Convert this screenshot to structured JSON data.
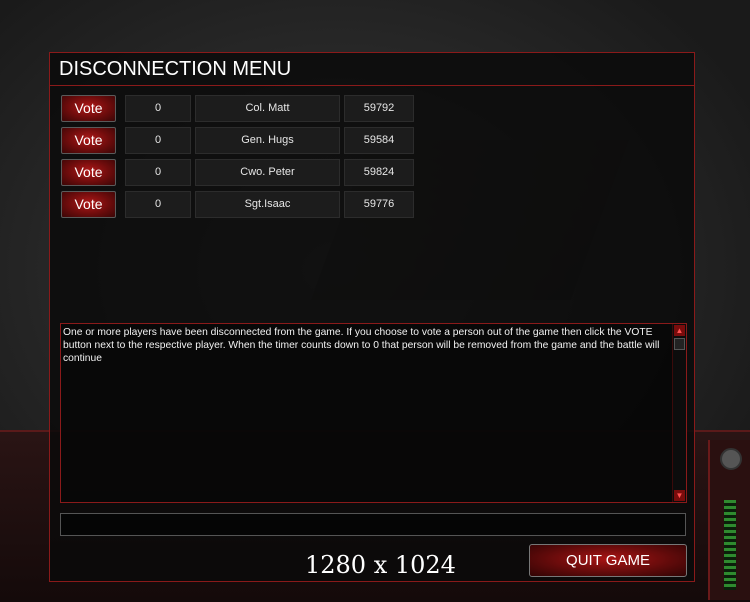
{
  "menu": {
    "title": "DISCONNECTION MENU"
  },
  "players": [
    {
      "vote_label": "Vote",
      "votes": "0",
      "name": "Col. Matt",
      "timer": "59792"
    },
    {
      "vote_label": "Vote",
      "votes": "0",
      "name": "Gen. Hugs",
      "timer": "59584"
    },
    {
      "vote_label": "Vote",
      "votes": "0",
      "name": "Cwo. Peter",
      "timer": "59824"
    },
    {
      "vote_label": "Vote",
      "votes": "0",
      "name": "Sgt.Isaac",
      "timer": "59776"
    }
  ],
  "message": {
    "text": "One or more players have been disconnected from the game. If you choose to vote a person out of the game then click the VOTE button next to the respective player. When the timer counts down to 0 that person will be removed from the game and the battle will continue"
  },
  "chat": {
    "value": ""
  },
  "footer": {
    "resolution": "1280 x 1024",
    "quit_label": "QUIT GAME"
  },
  "colors": {
    "accent": "#8a1a1a",
    "button_red": "#b01818"
  },
  "icons": [
    "arrow-up-icon",
    "arrow-down-icon",
    "gear-icon"
  ]
}
